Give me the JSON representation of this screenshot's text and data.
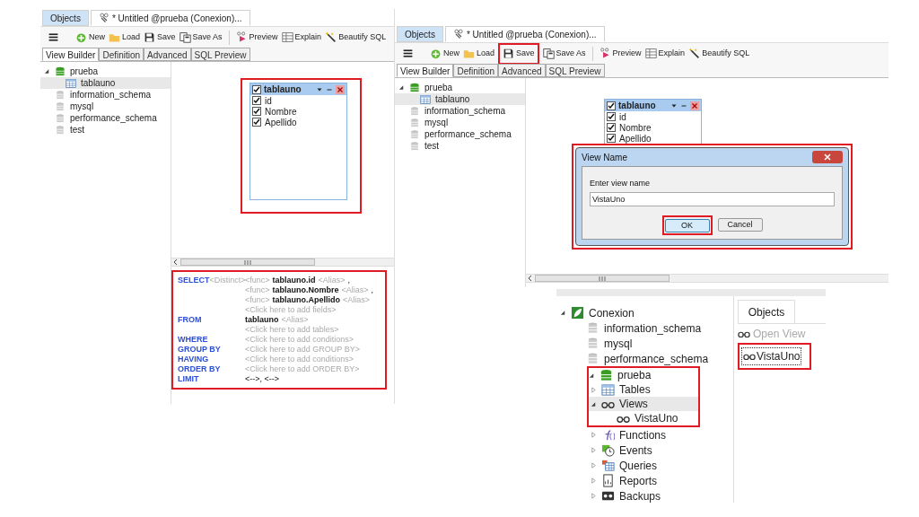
{
  "editor_before": {
    "tabs": [
      {
        "label": "Objects",
        "selected": false
      },
      {
        "label": "* Untitled @prueba (Conexion)...",
        "selected": true
      }
    ],
    "toolbar": [
      {
        "kind": "menu",
        "highlighted": false
      },
      {
        "kind": "new",
        "label": "New",
        "highlighted": false
      },
      {
        "kind": "load",
        "label": "Load",
        "highlighted": false
      },
      {
        "kind": "save",
        "label": "Save",
        "highlighted": false
      },
      {
        "kind": "save_as",
        "label": "Save As",
        "highlighted": false
      },
      {
        "kind": "separator"
      },
      {
        "kind": "preview",
        "label": "Preview",
        "highlighted": false
      },
      {
        "kind": "explain",
        "label": "Explain",
        "highlighted": false
      },
      {
        "kind": "beautify",
        "label": "Beautify SQL",
        "highlighted": false
      }
    ],
    "subtabs": [
      {
        "label": "View Builder",
        "selected": true
      },
      {
        "label": "Definition",
        "selected": false
      },
      {
        "label": "Advanced",
        "selected": false
      },
      {
        "label": "SQL Preview",
        "selected": false
      }
    ],
    "tree": [
      {
        "label": "prueba",
        "kind": "database",
        "expanded": true,
        "selected": false,
        "children": [
          {
            "label": "tablauno",
            "kind": "table",
            "selected": true
          }
        ]
      },
      {
        "label": "information_schema",
        "kind": "database_closed",
        "selected": false
      },
      {
        "label": "mysql",
        "kind": "database_closed",
        "selected": false
      },
      {
        "label": "performance_schema",
        "kind": "database_closed",
        "selected": false
      },
      {
        "label": "test",
        "kind": "database_closed",
        "selected": false
      }
    ],
    "table_widget": {
      "title": "tablauno",
      "checked": true,
      "highlighted": true,
      "fields": [
        {
          "label": "id",
          "checked": true
        },
        {
          "label": "Nombre",
          "checked": true
        },
        {
          "label": "Apellido",
          "checked": true
        }
      ]
    },
    "sql": {
      "highlighted": true,
      "lines": [
        {
          "keyword": "SELECT",
          "modifier": "<Distinct>",
          "parts": [
            {
              "kind": "hint",
              "text": "<func>"
            },
            {
              "kind": "name",
              "text": "tablauno.id"
            },
            {
              "kind": "hint",
              "text": "<Alias>"
            },
            {
              "kind": "plain",
              "text": ","
            }
          ]
        },
        {
          "parts": [
            {
              "kind": "hint",
              "text": "<func>"
            },
            {
              "kind": "name",
              "text": "tablauno.Nombre"
            },
            {
              "kind": "hint",
              "text": "<Alias>"
            },
            {
              "kind": "plain",
              "text": ","
            }
          ]
        },
        {
          "parts": [
            {
              "kind": "hint",
              "text": "<func>"
            },
            {
              "kind": "name",
              "text": "tablauno.Apellido"
            },
            {
              "kind": "hint",
              "text": "<Alias>"
            }
          ]
        },
        {
          "parts": [
            {
              "kind": "hint",
              "text": "<Click here to add fields>"
            }
          ]
        },
        {
          "keyword": "FROM",
          "parts": [
            {
              "kind": "name",
              "text": "tablauno"
            },
            {
              "kind": "hint",
              "text": "<Alias>"
            }
          ]
        },
        {
          "parts": [
            {
              "kind": "hint",
              "text": "<Click here to add tables>"
            }
          ]
        },
        {
          "keyword": "WHERE",
          "parts": [
            {
              "kind": "hint",
              "text": "<Click here to add conditions>"
            }
          ]
        },
        {
          "keyword": "GROUP BY",
          "parts": [
            {
              "kind": "hint",
              "text": "<Click here to add GROUP BY>"
            }
          ]
        },
        {
          "keyword": "HAVING",
          "parts": [
            {
              "kind": "hint",
              "text": "<Click here to add conditions>"
            }
          ]
        },
        {
          "keyword": "ORDER BY",
          "parts": [
            {
              "kind": "hint",
              "text": "<Click here to add ORDER BY>"
            }
          ]
        },
        {
          "keyword": "LIMIT",
          "parts": [
            {
              "kind": "plain",
              "text": "<-->, <-->"
            }
          ]
        }
      ]
    }
  },
  "editor_save": {
    "tabs": [
      {
        "label": "Objects",
        "selected": false
      },
      {
        "label": "* Untitled @prueba (Conexion)...",
        "selected": true
      }
    ],
    "toolbar": [
      {
        "kind": "menu",
        "highlighted": false
      },
      {
        "kind": "new",
        "label": "New",
        "highlighted": false
      },
      {
        "kind": "load",
        "label": "Load",
        "highlighted": false
      },
      {
        "kind": "save",
        "label": "Save",
        "highlighted": true
      },
      {
        "kind": "save_as",
        "label": "Save As",
        "highlighted": false
      },
      {
        "kind": "separator"
      },
      {
        "kind": "preview",
        "label": "Preview",
        "highlighted": false
      },
      {
        "kind": "explain",
        "label": "Explain",
        "highlighted": false
      },
      {
        "kind": "beautify",
        "label": "Beautify SQL",
        "highlighted": false
      }
    ],
    "subtabs": [
      {
        "label": "View Builder",
        "selected": true
      },
      {
        "label": "Definition",
        "selected": false
      },
      {
        "label": "Advanced",
        "selected": false
      },
      {
        "label": "SQL Preview",
        "selected": false
      }
    ],
    "tree": [
      {
        "label": "prueba",
        "kind": "database",
        "expanded": true,
        "selected": false,
        "children": [
          {
            "label": "tablauno",
            "kind": "table",
            "selected": true
          }
        ]
      },
      {
        "label": "information_schema",
        "kind": "database_closed",
        "selected": false
      },
      {
        "label": "mysql",
        "kind": "database_closed",
        "selected": false
      },
      {
        "label": "performance_schema",
        "kind": "database_closed",
        "selected": false
      },
      {
        "label": "test",
        "kind": "database_closed",
        "selected": false
      }
    ],
    "table_widget": {
      "title": "tablauno",
      "checked": true,
      "highlighted": false,
      "fields": [
        {
          "label": "id",
          "checked": true
        },
        {
          "label": "Nombre",
          "checked": true
        },
        {
          "label": "Apellido",
          "checked": true
        }
      ]
    },
    "dialog": {
      "title": "View Name",
      "highlighted": true,
      "label": "Enter view name",
      "value": "VistaUno",
      "buttons": [
        {
          "label": "OK",
          "focused": true,
          "highlighted": true
        },
        {
          "label": "Cancel",
          "focused": false,
          "highlighted": false
        }
      ]
    }
  },
  "navigator": {
    "tree": [
      {
        "label": "Conexion",
        "kind": "connection",
        "expanded": true,
        "selected": false,
        "highlighted": false,
        "children": [
          {
            "label": "information_schema",
            "kind": "database_closed",
            "selected": false,
            "highlighted": false
          },
          {
            "label": "mysql",
            "kind": "database_closed",
            "selected": false,
            "highlighted": false
          },
          {
            "label": "performance_schema",
            "kind": "database_closed",
            "selected": false,
            "highlighted": false
          },
          {
            "label": "prueba",
            "kind": "database",
            "expanded": true,
            "selected": false,
            "highlighted": true,
            "children": [
              {
                "label": "Tables",
                "kind": "tables",
                "expanded": false,
                "selected": false,
                "highlighted": true
              },
              {
                "label": "Views",
                "kind": "views",
                "expanded": true,
                "selected": true,
                "highlighted": true,
                "children": [
                  {
                    "label": "VistaUno",
                    "kind": "view",
                    "selected": false,
                    "highlighted": true
                  }
                ]
              },
              {
                "label": "Functions",
                "kind": "functions",
                "expanded": false,
                "selected": false,
                "highlighted": false
              },
              {
                "label": "Events",
                "kind": "events",
                "expanded": false,
                "selected": false,
                "highlighted": false
              },
              {
                "label": "Queries",
                "kind": "queries",
                "expanded": false,
                "selected": false,
                "highlighted": false
              },
              {
                "label": "Reports",
                "kind": "reports",
                "expanded": false,
                "selected": false,
                "highlighted": false
              },
              {
                "label": "Backups",
                "kind": "backups",
                "expanded": false,
                "selected": false,
                "highlighted": false
              }
            ]
          }
        ]
      }
    ],
    "objects": {
      "tab": "Objects",
      "toolbar": [
        {
          "label": "Open View",
          "disabled": true
        }
      ],
      "items": [
        {
          "label": "VistaUno",
          "selected": true,
          "highlighted": true
        }
      ]
    }
  }
}
